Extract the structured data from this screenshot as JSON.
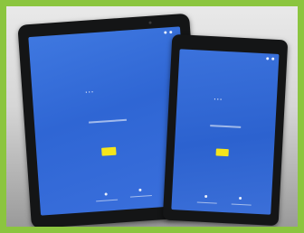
{
  "photo": {
    "frame_color": "#8bc53f",
    "screen_color": "#2f66d4",
    "button_color": "#f5e51b",
    "subject": "two-tablets-on-setup-screen"
  }
}
